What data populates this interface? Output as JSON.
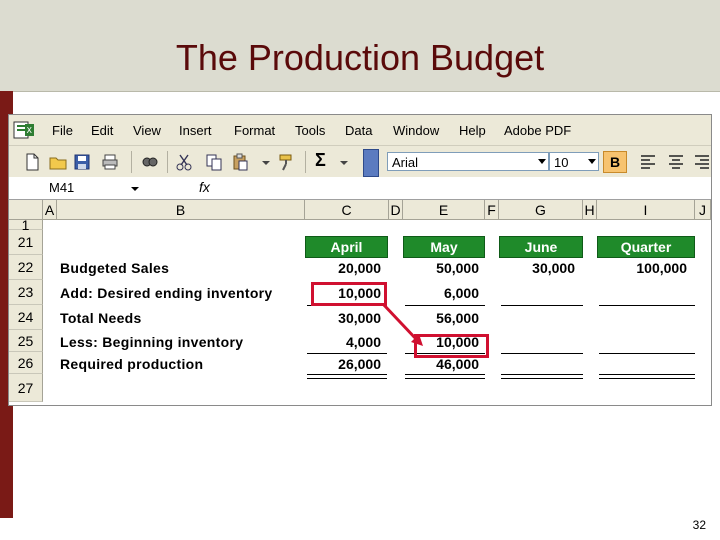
{
  "slide": {
    "title": "The Production Budget",
    "number": "32"
  },
  "menu": [
    "File",
    "Edit",
    "View",
    "Insert",
    "Format",
    "Tools",
    "Data",
    "Window",
    "Help",
    "Adobe PDF"
  ],
  "toolbar": {
    "font": "Arial",
    "size": "10",
    "bold": "B",
    "sum": "Σ"
  },
  "formula_bar": {
    "cell_ref": "M41",
    "fx": "fx"
  },
  "columns": [
    "A",
    "B",
    "C",
    "D",
    "E",
    "F",
    "G",
    "H",
    "I",
    "J"
  ],
  "rows": [
    "1",
    "21",
    "22",
    "23",
    "24",
    "25",
    "26",
    "27"
  ],
  "headers": {
    "april": "April",
    "may": "May",
    "june": "June",
    "quarter": "Quarter"
  },
  "table": {
    "budgeted_sales": {
      "label": "Budgeted Sales",
      "april": "20,000",
      "may": "50,000",
      "june": "30,000",
      "quarter": "100,000"
    },
    "desired_ending": {
      "label": "Add: Desired ending inventory",
      "april": "10,000",
      "may": "6,000"
    },
    "total_needs": {
      "label": "Total Needs",
      "april": "30,000",
      "may": "56,000"
    },
    "beginning_inv": {
      "label": "Less: Beginning inventory",
      "april": "4,000",
      "may": "10,000"
    },
    "required_prod": {
      "label": "Required production",
      "april": "26,000",
      "may": "46,000"
    }
  },
  "colors": {
    "header_green": "#1f8a2a",
    "highlight_red": "#d01030",
    "title_color": "#5a0a0a",
    "side_bar": "#7a1a16"
  }
}
